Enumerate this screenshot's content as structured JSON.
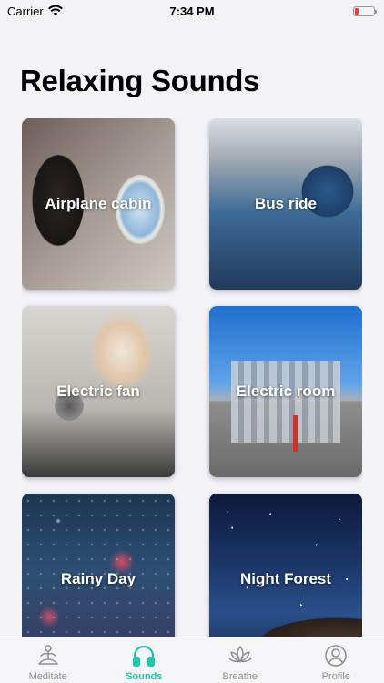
{
  "status_bar": {
    "carrier": "Carrier",
    "time": "7:34 PM",
    "battery_level_fraction": 0.2
  },
  "page": {
    "title": "Relaxing Sounds"
  },
  "sounds": [
    {
      "label": "Airplane cabin"
    },
    {
      "label": "Bus ride"
    },
    {
      "label": "Electric fan"
    },
    {
      "label": "Electric room"
    },
    {
      "label": "Rainy Day"
    },
    {
      "label": "Night Forest"
    }
  ],
  "tab_bar": {
    "tabs": [
      {
        "label": "Meditate",
        "icon": "meditate-icon"
      },
      {
        "label": "Sounds",
        "icon": "headphones-icon",
        "active": true
      },
      {
        "label": "Breathe",
        "icon": "lotus-icon"
      },
      {
        "label": "Profile",
        "icon": "profile-icon"
      }
    ]
  },
  "colors": {
    "accent": "#1fc8a9",
    "inactive": "#8e8e93",
    "background": "#f2f2f7",
    "battery_low": "#ff3b30"
  }
}
